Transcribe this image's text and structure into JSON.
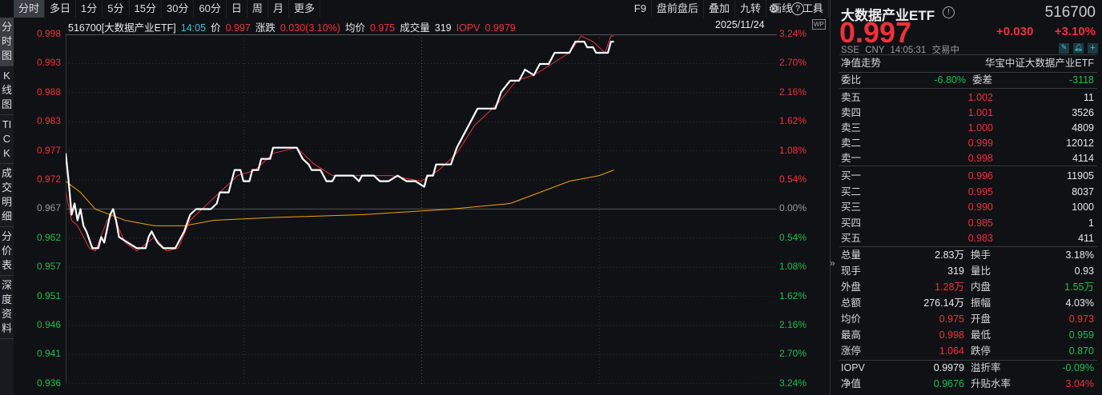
{
  "toolbar": {
    "tabs": [
      "分时",
      "多日",
      "1分",
      "5分",
      "15分",
      "30分",
      "60分",
      "日",
      "周",
      "月",
      "更多"
    ],
    "right": [
      "F9",
      "盘前盘后",
      "叠加",
      "九转",
      "画线",
      "工具"
    ]
  },
  "sidebar": [
    "分时图",
    "K线图",
    "TICK",
    "成交明细",
    "分价表",
    "深度资料"
  ],
  "info": {
    "code": "516700[大数据产业ETF]",
    "time": "14:05",
    "price_label": "价",
    "price": "0.997",
    "change_label": "涨跌",
    "change": "0.030(3.10%)",
    "avg_label": "均价",
    "avg": "0.975",
    "vol_label": "成交量",
    "vol": "319",
    "iopv_label": "IOPV",
    "iopv": "0.9979",
    "date": "2025/11/24",
    "wp": "WP"
  },
  "chart_data": {
    "type": "line",
    "ylim": [
      0.9357,
      0.9983
    ],
    "xlim": [
      0,
      240
    ],
    "y_ticks": [
      "0.998",
      "0.993",
      "0.988",
      "0.983",
      "0.977",
      "0.972",
      "0.967",
      "0.962",
      "0.957",
      "0.951",
      "0.946",
      "0.941",
      "0.936"
    ],
    "pct_ticks": [
      "3.24%",
      "2.70%",
      "2.16%",
      "1.62%",
      "1.08%",
      "0.54%",
      "0.00%",
      "0.54%",
      "1.08%",
      "1.62%",
      "2.16%",
      "2.70%",
      "3.24%"
    ],
    "series": [
      {
        "name": "price",
        "color": "#ffffff",
        "x": [
          0,
          1,
          2,
          3,
          4,
          5,
          6,
          7,
          9,
          11,
          12,
          13,
          15,
          16,
          17,
          18,
          21,
          24,
          27,
          28,
          29,
          30,
          31,
          33,
          37,
          38,
          40,
          42,
          44,
          49,
          51,
          52,
          55,
          56,
          57,
          59,
          60,
          62,
          63,
          65,
          66,
          69,
          70,
          78,
          80,
          82,
          83,
          86,
          88,
          90,
          91,
          97,
          99,
          100,
          104,
          106,
          109,
          112,
          115,
          118,
          121,
          122,
          124,
          125,
          130,
          132,
          134,
          137,
          139,
          145,
          147,
          150,
          153,
          155,
          158,
          160,
          163,
          165,
          170,
          172,
          175,
          176,
          178,
          179,
          183,
          184,
          185
        ],
        "y": [
          0.977,
          0.972,
          0.966,
          0.968,
          0.965,
          0.967,
          0.964,
          0.963,
          0.96,
          0.96,
          0.962,
          0.961,
          0.966,
          0.967,
          0.965,
          0.962,
          0.961,
          0.96,
          0.96,
          0.962,
          0.963,
          0.962,
          0.961,
          0.96,
          0.96,
          0.961,
          0.963,
          0.966,
          0.967,
          0.967,
          0.968,
          0.97,
          0.97,
          0.972,
          0.974,
          0.974,
          0.972,
          0.972,
          0.974,
          0.974,
          0.976,
          0.976,
          0.978,
          0.978,
          0.976,
          0.975,
          0.974,
          0.974,
          0.972,
          0.972,
          0.973,
          0.973,
          0.972,
          0.973,
          0.973,
          0.972,
          0.972,
          0.973,
          0.972,
          0.972,
          0.971,
          0.973,
          0.973,
          0.975,
          0.975,
          0.978,
          0.98,
          0.983,
          0.985,
          0.985,
          0.988,
          0.99,
          0.99,
          0.992,
          0.991,
          0.993,
          0.993,
          0.995,
          0.995,
          0.997,
          0.997,
          0.996,
          0.996,
          0.995,
          0.995,
          0.997,
          0.997
        ]
      },
      {
        "name": "iopv",
        "color": "#e8333d",
        "x": [
          0,
          2,
          4,
          6,
          8,
          10,
          14,
          16,
          20,
          24,
          30,
          34,
          38,
          42,
          46,
          52,
          58,
          64,
          70,
          78,
          84,
          90,
          100,
          110,
          120,
          126,
          132,
          138,
          146,
          152,
          158,
          164,
          170,
          174,
          178,
          182,
          184,
          185
        ],
        "y": [
          0.97,
          0.965,
          0.964,
          0.962,
          0.96,
          0.9595,
          0.965,
          0.966,
          0.961,
          0.9595,
          0.962,
          0.9595,
          0.96,
          0.965,
          0.967,
          0.97,
          0.973,
          0.974,
          0.977,
          0.978,
          0.975,
          0.973,
          0.973,
          0.973,
          0.972,
          0.974,
          0.977,
          0.982,
          0.986,
          0.99,
          0.991,
          0.993,
          0.995,
          0.998,
          0.997,
          0.995,
          0.998,
          0.998
        ]
      },
      {
        "name": "avg",
        "color": "#f0a500",
        "x": [
          0,
          5,
          10,
          20,
          30,
          40,
          50,
          70,
          100,
          130,
          140,
          150,
          160,
          170,
          180,
          185
        ],
        "y": [
          0.972,
          0.97,
          0.967,
          0.965,
          0.964,
          0.964,
          0.965,
          0.9655,
          0.966,
          0.967,
          0.9675,
          0.968,
          0.97,
          0.972,
          0.973,
          0.974
        ]
      }
    ]
  },
  "panel": {
    "name": "大数据产业ETF",
    "code": "516700",
    "price": "0.997",
    "change": "+0.030",
    "change_pct": "+3.10%",
    "exchange": "SSE",
    "currency": "CNY",
    "time": "14:05:31",
    "status": "交易中",
    "nav_trend": "净值走势",
    "index_name": "华宝中证大数据产业ETF",
    "wb_label": "委比",
    "wb": "-6.80%",
    "wc_label": "委差",
    "wc": "-3118",
    "asks": [
      {
        "label": "卖五",
        "price": "1.002",
        "vol": "11"
      },
      {
        "label": "卖四",
        "price": "1.001",
        "vol": "3526"
      },
      {
        "label": "卖三",
        "price": "1.000",
        "vol": "4809"
      },
      {
        "label": "卖二",
        "price": "0.999",
        "vol": "12012"
      },
      {
        "label": "卖一",
        "price": "0.998",
        "vol": "4114"
      }
    ],
    "bids": [
      {
        "label": "买一",
        "price": "0.996",
        "vol": "11905"
      },
      {
        "label": "买二",
        "price": "0.995",
        "vol": "8037"
      },
      {
        "label": "买三",
        "price": "0.990",
        "vol": "1000"
      },
      {
        "label": "买四",
        "price": "0.985",
        "vol": "1"
      },
      {
        "label": "买五",
        "price": "0.983",
        "vol": "411"
      }
    ],
    "stats": [
      [
        "总量",
        "2.83万",
        "white",
        "换手",
        "3.18%",
        "white"
      ],
      [
        "现手",
        "319",
        "white",
        "量比",
        "0.93",
        "white"
      ],
      [
        "外盘",
        "1.28万",
        "red",
        "内盘",
        "1.55万",
        "green"
      ],
      [
        "总额",
        "276.14万",
        "white",
        "振幅",
        "4.03%",
        "white"
      ],
      [
        "均价",
        "0.975",
        "red",
        "开盘",
        "0.973",
        "red"
      ],
      [
        "最高",
        "0.998",
        "red",
        "最低",
        "0.959",
        "green"
      ],
      [
        "涨停",
        "1.064",
        "red",
        "跌停",
        "0.870",
        "green"
      ]
    ],
    "iopv": [
      [
        "IOPV",
        "0.9979",
        "white",
        "溢折率",
        "-0.09%",
        "green"
      ],
      [
        "净值",
        "0.9676",
        "green",
        "升贴水率",
        "3.04%",
        "red"
      ]
    ]
  }
}
